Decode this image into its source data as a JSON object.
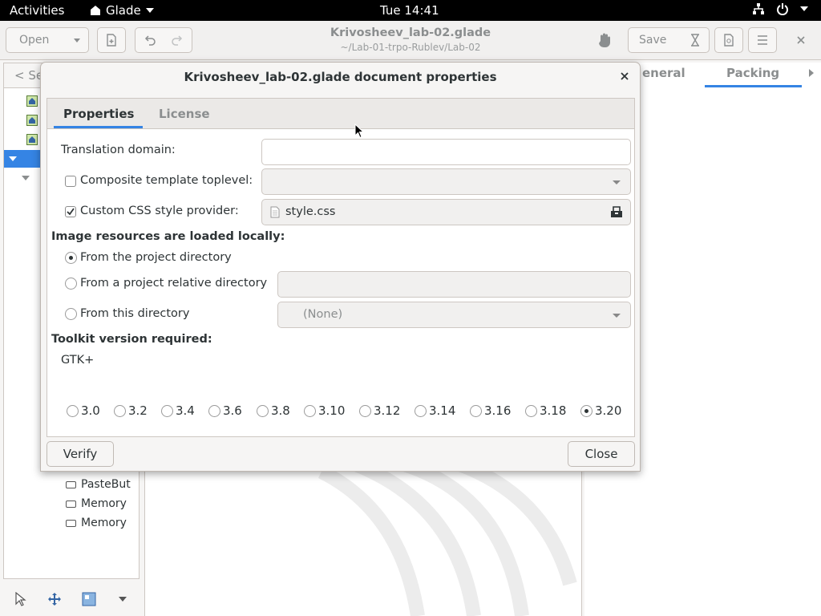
{
  "topbar": {
    "activities": "Activities",
    "app": "Glade",
    "clock": "Tue 14:41"
  },
  "header": {
    "open_label": "Open",
    "save_label": "Save",
    "title": "Krivosheev_lab-02.glade",
    "subtitle": "~/Lab-01-trpo-Rublev/Lab-02"
  },
  "left_panel": {
    "search_label": "< Se",
    "tree_items": [
      "PasteBut",
      "Memory",
      "Memory"
    ]
  },
  "right_panel": {
    "tabs": [
      "eneral",
      "Packing"
    ]
  },
  "dialog": {
    "title": "Krivosheev_lab-02.glade document properties",
    "tabs": {
      "properties": "Properties",
      "license": "License"
    },
    "translation_domain_label": "Translation domain:",
    "translation_domain_value": "",
    "composite_label": "Composite template toplevel:",
    "composite_checked": false,
    "css_label": "Custom CSS style provider:",
    "css_checked": true,
    "css_file": "style.css",
    "images_heading": "Image resources are loaded locally:",
    "image_options": [
      "From the project directory",
      "From a project relative directory",
      "From this directory"
    ],
    "image_selected": 0,
    "this_directory_value": "(None)",
    "toolkit_heading": "Toolkit version required:",
    "toolkit_name": "GTK+",
    "versions": [
      "3.0",
      "3.2",
      "3.4",
      "3.6",
      "3.8",
      "3.10",
      "3.12",
      "3.14",
      "3.16",
      "3.18",
      "3.20"
    ],
    "version_selected": "3.20",
    "verify_label": "Verify",
    "close_label": "Close"
  }
}
